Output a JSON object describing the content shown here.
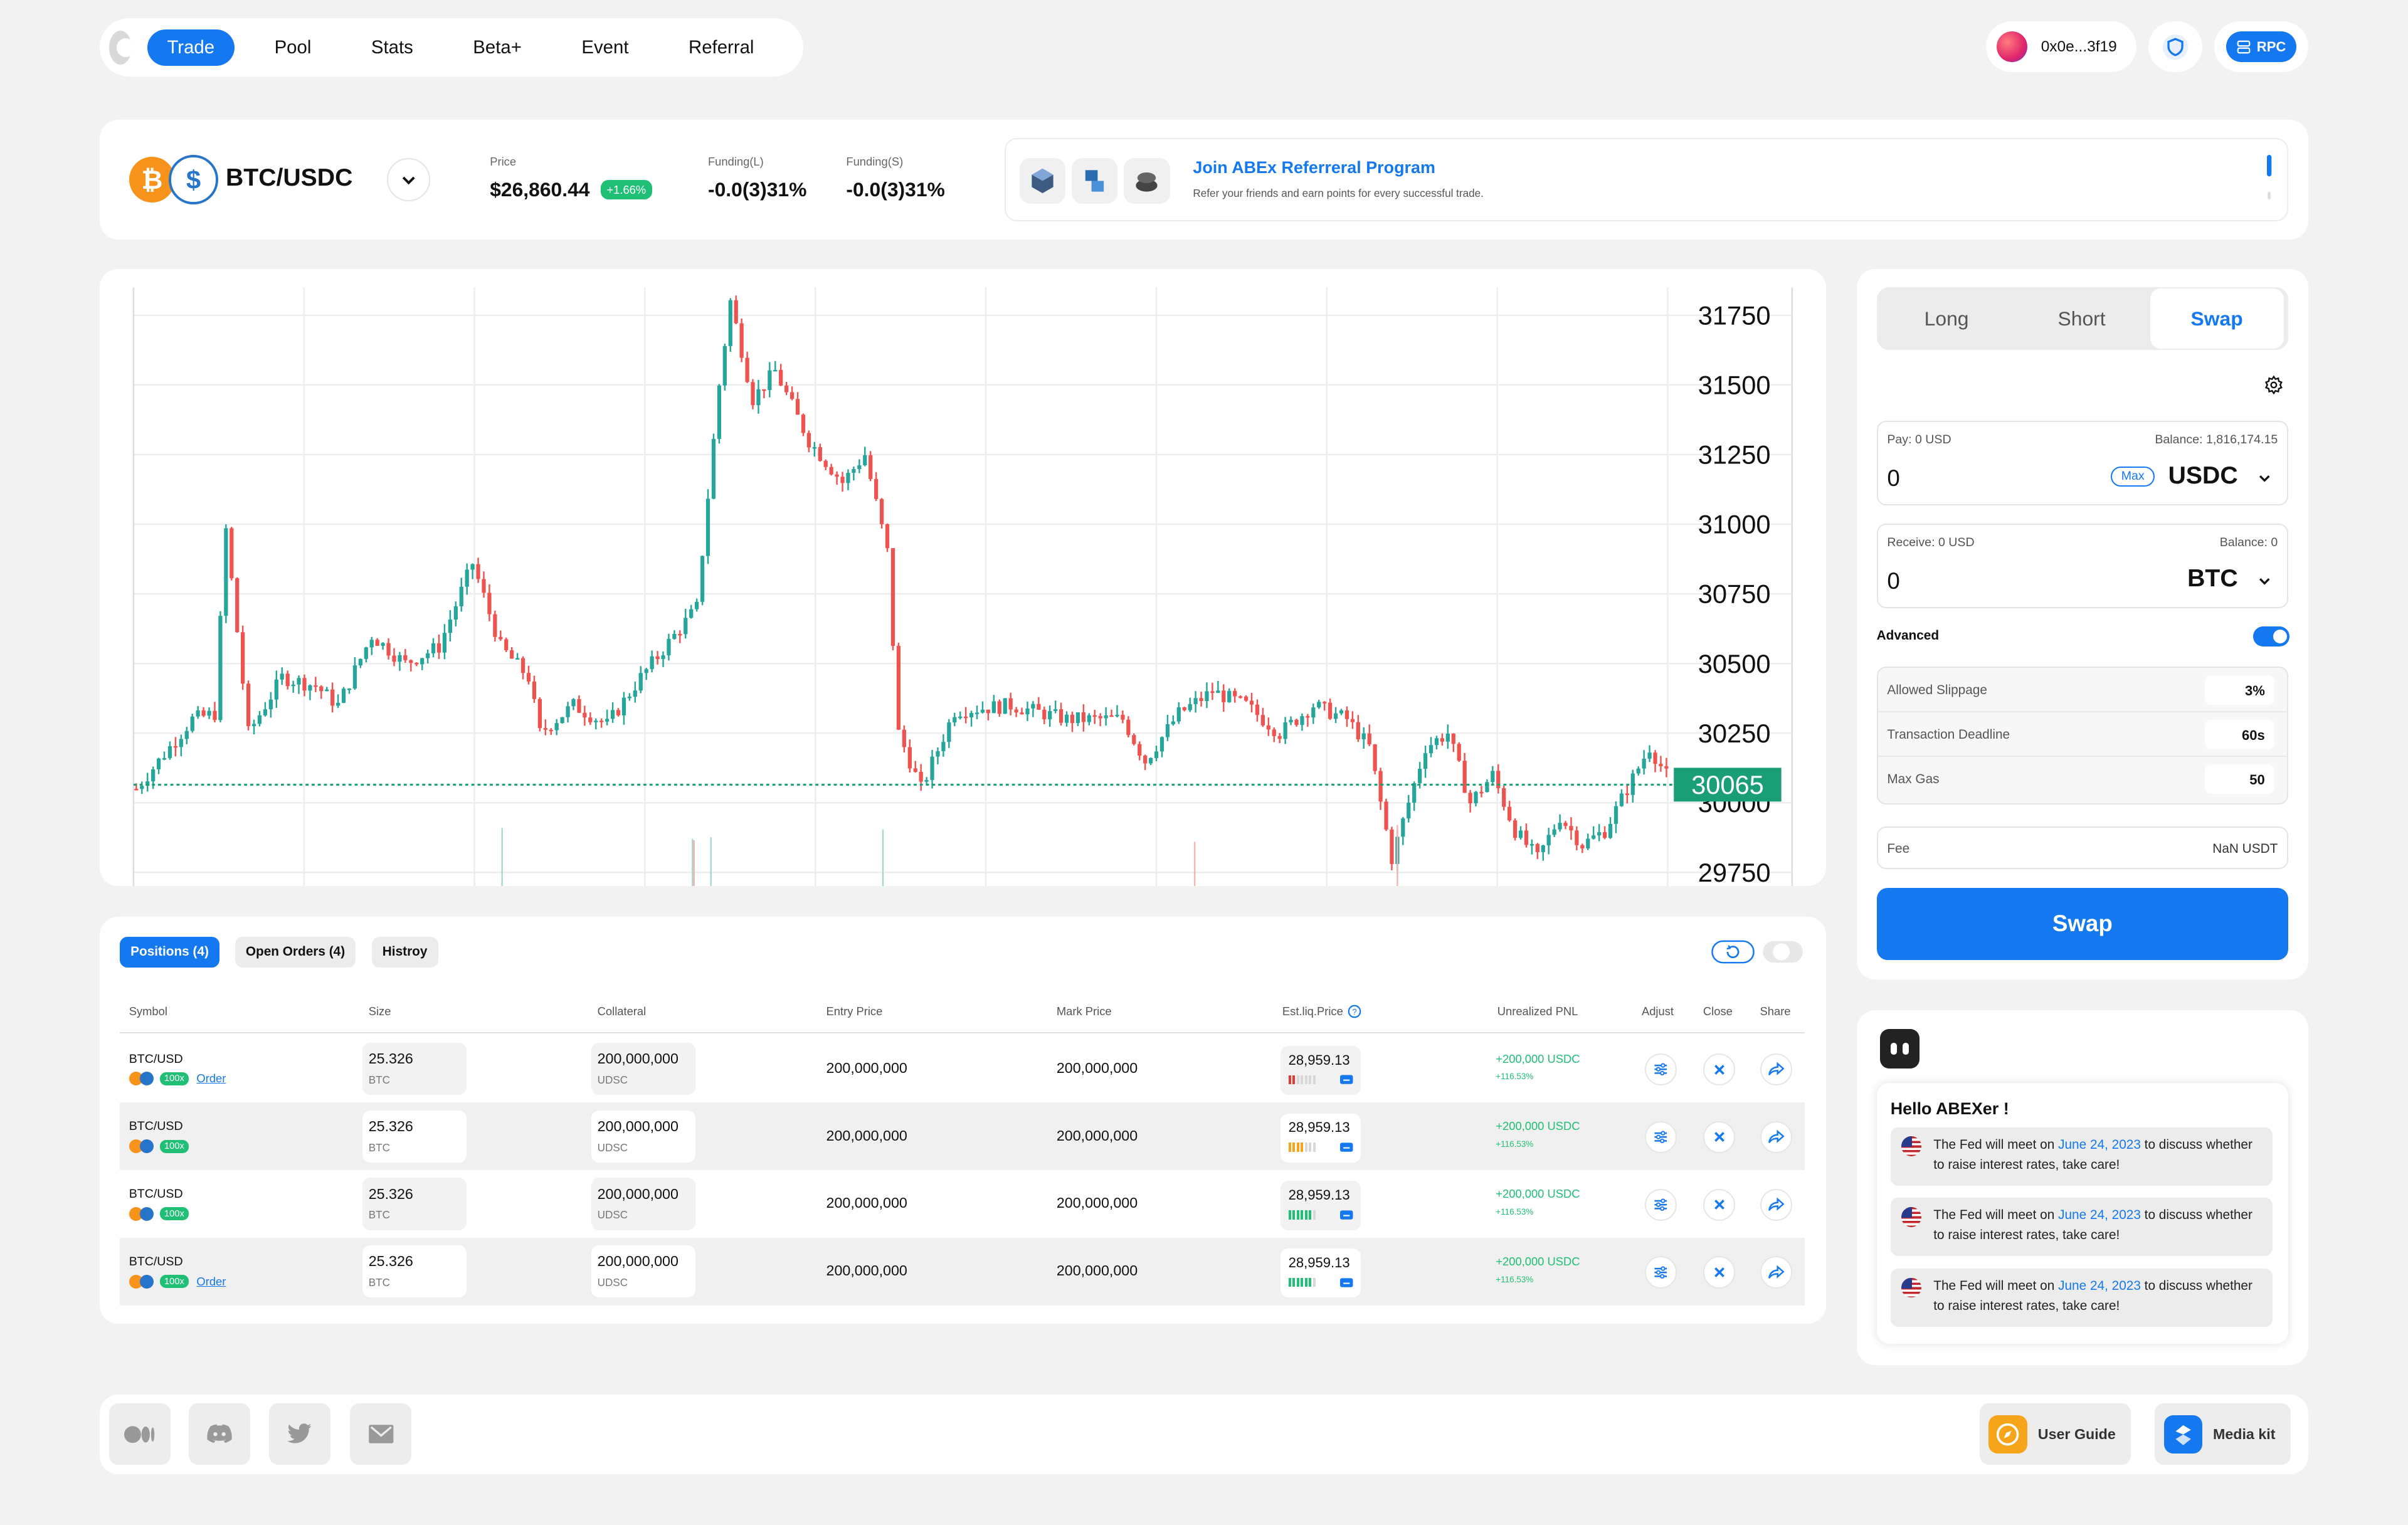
{
  "nav": {
    "items": [
      {
        "label": "Trade",
        "active": true
      },
      {
        "label": "Pool",
        "active": false
      },
      {
        "label": "Stats",
        "active": false
      },
      {
        "label": "Beta+",
        "active": false
      },
      {
        "label": "Event",
        "active": false
      },
      {
        "label": "Referral",
        "active": false
      }
    ],
    "wallet": "0x0e...3f19",
    "rpc_label": "RPC"
  },
  "ticker": {
    "pair": "BTC/USDC",
    "price_label": "Price",
    "price": "$26,860.44",
    "change": "+1.66%",
    "funding_long_label": "Funding(L)",
    "funding_long": "-0.0(3)31%",
    "funding_short_label": "Funding(S)",
    "funding_short": "-0.0(3)31%",
    "banner_title": "Join ABEx Referreral Program",
    "banner_sub": "Refer your friends and earn points for every successful trade."
  },
  "chart_data": {
    "type": "candlestick",
    "y_ticks": [
      "31750",
      "31500",
      "31250",
      "31000",
      "30750",
      "30500",
      "30250",
      "30000",
      "29750"
    ],
    "ylim": [
      29700,
      31850
    ],
    "last_price": "30065",
    "grid": true,
    "colors": {
      "up": "#26a69a",
      "down": "#ef5350",
      "last_line": "#1a9e76"
    },
    "path": [
      [
        0,
        30050
      ],
      [
        10,
        30300
      ],
      [
        14,
        30320
      ],
      [
        16,
        30980
      ],
      [
        20,
        30250
      ],
      [
        26,
        30450
      ],
      [
        32,
        30420
      ],
      [
        36,
        30350
      ],
      [
        42,
        30600
      ],
      [
        48,
        30500
      ],
      [
        54,
        30560
      ],
      [
        60,
        30860
      ],
      [
        65,
        30560
      ],
      [
        70,
        30450
      ],
      [
        72,
        30250
      ],
      [
        78,
        30350
      ],
      [
        84,
        30280
      ],
      [
        90,
        30450
      ],
      [
        96,
        30600
      ],
      [
        100,
        30700
      ],
      [
        104,
        31500
      ],
      [
        106,
        31800
      ],
      [
        110,
        31450
      ],
      [
        114,
        31550
      ],
      [
        120,
        31300
      ],
      [
        126,
        31150
      ],
      [
        130,
        31250
      ],
      [
        134,
        30900
      ],
      [
        136,
        30250
      ],
      [
        140,
        30050
      ],
      [
        146,
        30330
      ],
      [
        156,
        30350
      ],
      [
        166,
        30300
      ],
      [
        176,
        30300
      ],
      [
        180,
        30150
      ],
      [
        186,
        30320
      ],
      [
        192,
        30400
      ],
      [
        198,
        30350
      ],
      [
        204,
        30250
      ],
      [
        210,
        30350
      ],
      [
        216,
        30300
      ],
      [
        220,
        30200
      ],
      [
        224,
        29800
      ],
      [
        230,
        30200
      ],
      [
        234,
        30250
      ],
      [
        238,
        30000
      ],
      [
        242,
        30100
      ],
      [
        246,
        29900
      ],
      [
        250,
        29800
      ],
      [
        254,
        29950
      ],
      [
        258,
        29850
      ],
      [
        262,
        29900
      ],
      [
        266,
        30050
      ],
      [
        270,
        30200
      ],
      [
        274,
        30065
      ]
    ]
  },
  "positions": {
    "tabs": [
      "Positions (4)",
      "Open Orders (4)",
      "Histroy"
    ],
    "headers": [
      "Symbol",
      "Size",
      "Collateral",
      "Entry Price",
      "Mark Price",
      "Est.liq.Price",
      "Unrealized PNL",
      "Adjust",
      "Close",
      "Share"
    ],
    "rows": [
      {
        "symbol": "BTC/USD",
        "lev": "100x",
        "order": "Order",
        "size": "25.326",
        "size_unit": "BTC",
        "collateral": "200,000,000",
        "collateral_unit": "UDSC",
        "entry": "200,000,000",
        "mark": "200,000,000",
        "liq": "28,959.13",
        "risk": 2,
        "pnl": "+200,000 USDC",
        "pnl_pct": "+116.53%"
      },
      {
        "symbol": "BTC/USD",
        "lev": "100x",
        "order": "",
        "size": "25.326",
        "size_unit": "BTC",
        "collateral": "200,000,000",
        "collateral_unit": "UDSC",
        "entry": "200,000,000",
        "mark": "200,000,000",
        "liq": "28,959.13",
        "risk": 4,
        "pnl": "+200,000 USDC",
        "pnl_pct": "+116.53%"
      },
      {
        "symbol": "BTC/USD",
        "lev": "100x",
        "order": "",
        "size": "25.326",
        "size_unit": "BTC",
        "collateral": "200,000,000",
        "collateral_unit": "UDSC",
        "entry": "200,000,000",
        "mark": "200,000,000",
        "liq": "28,959.13",
        "risk": 6,
        "pnl": "+200,000 USDC",
        "pnl_pct": "+116.53%"
      },
      {
        "symbol": "BTC/USD",
        "lev": "100x",
        "order": "Order",
        "size": "25.326",
        "size_unit": "BTC",
        "collateral": "200,000,000",
        "collateral_unit": "UDSC",
        "entry": "200,000,000",
        "mark": "200,000,000",
        "liq": "28,959.13",
        "risk": 6,
        "pnl": "+200,000 USDC",
        "pnl_pct": "+116.53%"
      }
    ]
  },
  "swap": {
    "tabs": [
      "Long",
      "Short",
      "Swap"
    ],
    "pay_label": "Pay: 0 USD",
    "pay_balance": "Balance: 1,816,174.15",
    "pay_value": "0",
    "max_label": "Max",
    "pay_token": "USDC",
    "receive_label": "Receive: 0 USD",
    "receive_balance": "Balance: 0",
    "receive_value": "0",
    "receive_token": "BTC",
    "advanced_label": "Advanced",
    "settings": [
      {
        "label": "Allowed Slippage",
        "value": "3%"
      },
      {
        "label": "Transaction Deadline",
        "value": "60s"
      },
      {
        "label": "Max Gas",
        "value": "50"
      }
    ],
    "fee_label": "Fee",
    "fee_value": "NaN USDT",
    "button": "Swap"
  },
  "notifications": {
    "greeting": "Hello ABEXer !",
    "messages": [
      {
        "pre": "The Fed will meet on ",
        "date": "June 24, 2023",
        "post": " to discuss whether to raise interest rates, take care!"
      },
      {
        "pre": "The Fed will meet on ",
        "date": "June 24, 2023",
        "post": " to discuss whether to raise interest rates, take care!"
      },
      {
        "pre": "The Fed will meet on ",
        "date": "June 24, 2023",
        "post": " to discuss whether to raise interest rates, take care!"
      }
    ]
  },
  "footer": {
    "user_guide": "User Guide",
    "media_kit": "Media kit"
  }
}
